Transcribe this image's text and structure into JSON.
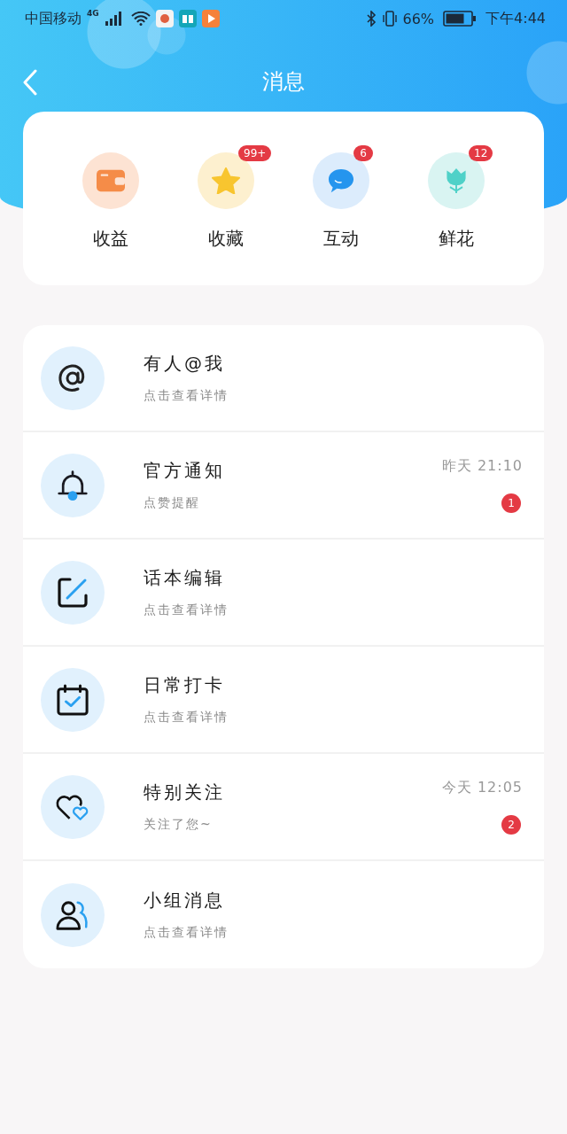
{
  "status_bar": {
    "carrier": "中国移动",
    "network": "4G",
    "battery": "66%",
    "time": "下午4:44"
  },
  "header": {
    "title": "消息"
  },
  "categories": [
    {
      "kind": "wallet",
      "label": "收益"
    },
    {
      "kind": "star",
      "label": "收藏",
      "badge": "99+"
    },
    {
      "kind": "chat",
      "label": "互动",
      "badge": "6"
    },
    {
      "kind": "flower",
      "label": "鲜花",
      "badge": "12"
    }
  ],
  "messages": [
    {
      "kind": "at",
      "title": "有人@我",
      "subtitle": "点击查看详情"
    },
    {
      "kind": "bell",
      "title": "官方通知",
      "subtitle": "点赞提醒",
      "time": "昨天 21:10",
      "badge": "1"
    },
    {
      "kind": "edit",
      "title": "话本编辑",
      "subtitle": "点击查看详情"
    },
    {
      "kind": "calendar",
      "title": "日常打卡",
      "subtitle": "点击查看详情"
    },
    {
      "kind": "hearts",
      "title": "特别关注",
      "subtitle": "关注了您~",
      "time": "今天 12:05",
      "badge": "2"
    },
    {
      "kind": "group",
      "title": "小组消息",
      "subtitle": "点击查看详情"
    }
  ]
}
